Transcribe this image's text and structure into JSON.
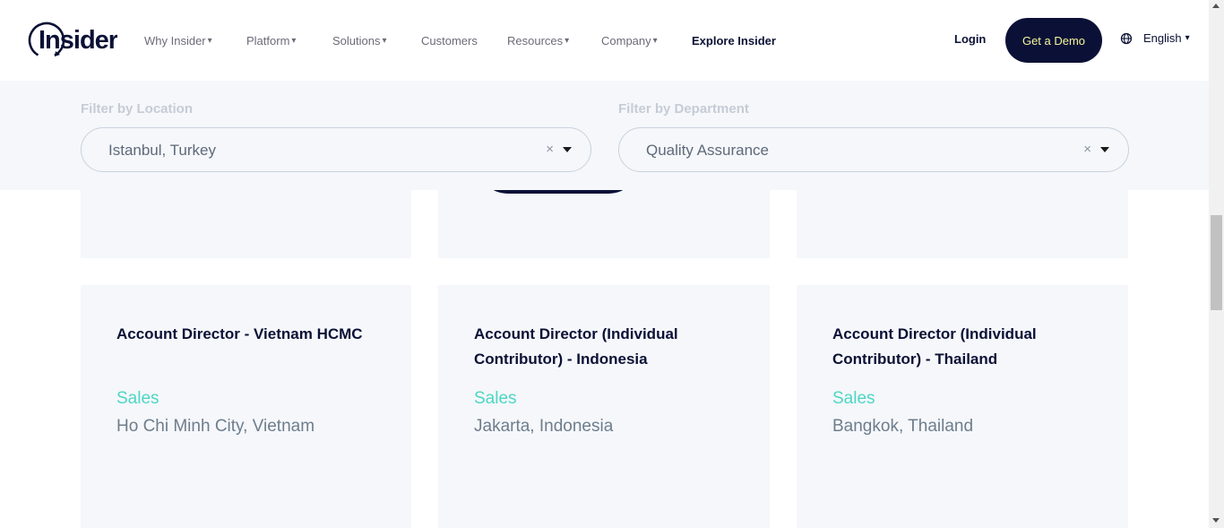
{
  "header": {
    "logo_text": "Insider",
    "nav": [
      {
        "label": "Why Insider",
        "caret": "▾"
      },
      {
        "label": "Platform",
        "caret": "▾"
      },
      {
        "label": "Solutions",
        "caret": "▾"
      },
      {
        "label": "Customers",
        "caret": ""
      },
      {
        "label": "Resources",
        "caret": "▾"
      },
      {
        "label": "Company",
        "caret": "▾"
      },
      {
        "label": "Explore Insider",
        "caret": ""
      }
    ],
    "login_label": "Login",
    "demo_label": "Get a Demo",
    "language_label": "English",
    "language_caret": "▾",
    "globe_icon": "globe-icon"
  },
  "filters": {
    "location": {
      "label": "Filter by Location",
      "value": "Istanbul, Turkey",
      "clear": "×"
    },
    "department": {
      "label": "Filter by Department",
      "value": "Quality Assurance",
      "clear": "×"
    }
  },
  "jobs": [
    {
      "title": "Account Director - Vietnam HCMC",
      "department": "Sales",
      "location": "Ho Chi Minh City, Vietnam"
    },
    {
      "title": "Account Director (Individual Contributor) - Indonesia",
      "department": "Sales",
      "location": "Jakarta, Indonesia"
    },
    {
      "title": "Account Director (Individual Contributor) - Thailand",
      "department": "Sales",
      "location": "Bangkok, Thailand"
    }
  ],
  "colors": {
    "navy": "#0b1136",
    "accent_teal": "#4dd6c4",
    "demo_text": "#f5f59c",
    "panel_bg": "#f5f7fa"
  }
}
